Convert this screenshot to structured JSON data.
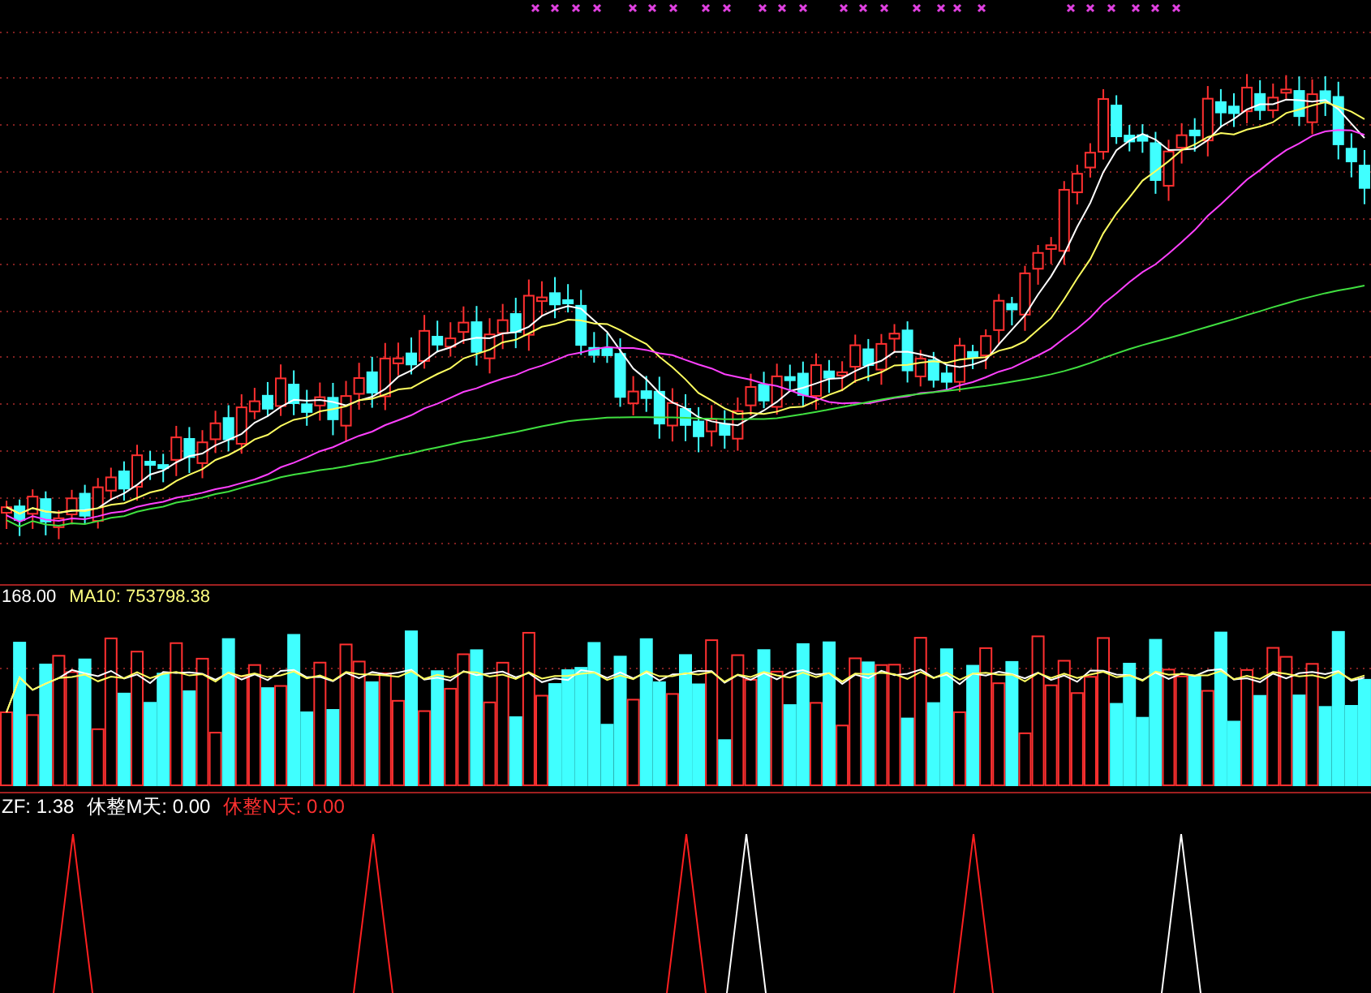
{
  "volume_legend": [
    {
      "text": "168.00",
      "color": "#ffffff"
    },
    {
      "text": "MA10: 753798.38",
      "color": "#ffff80"
    }
  ],
  "indicator_legend": [
    {
      "text": "ZF: 1.38",
      "color": "#ffffff"
    },
    {
      "text": "休整M天: 0.00",
      "color": "#ffffff"
    },
    {
      "text": "休整N天: 0.00",
      "color": "#ff3030"
    }
  ]
}
